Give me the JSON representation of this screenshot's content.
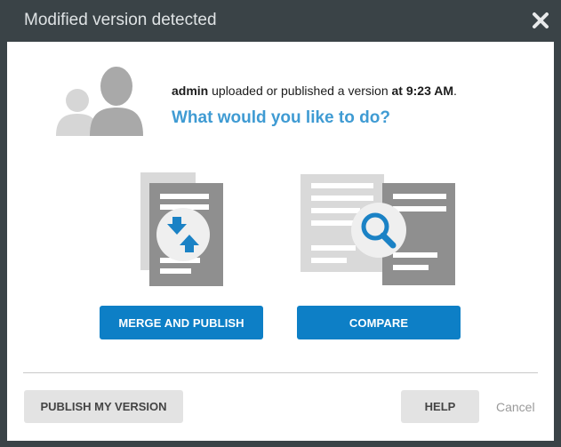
{
  "dialog": {
    "title": "Modified version detected",
    "close_icon": "close-icon"
  },
  "message": {
    "user": "admin",
    "middle": " uploaded or published a version ",
    "time_prefix": "at 9:23 AM",
    "end": ".",
    "question": "What would you like to do?"
  },
  "actions": {
    "merge_label": "MERGE AND PUBLISH",
    "compare_label": "COMPARE"
  },
  "footer": {
    "publish_label": "PUBLISH MY VERSION",
    "help_label": "HELP",
    "cancel_label": "Cancel"
  },
  "colors": {
    "accent": "#0d7fc6",
    "question": "#3f9bd3",
    "frame": "#3a4347"
  },
  "icons": {
    "avatars": "users-icon",
    "merge": "merge-document-icon",
    "compare": "compare-document-icon"
  }
}
